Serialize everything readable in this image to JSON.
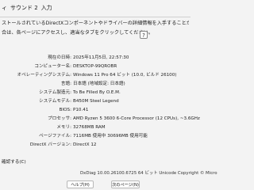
{
  "tabs": {
    "items": [
      "ィ",
      "サウンド 2",
      "入力"
    ]
  },
  "intro": {
    "line1": "ストールされているDirectXコンポーネントやドライバーの詳細情報を入手することができます。",
    "line2": "合は、各ページにアクセスし、適当なタブをクリックしてください。",
    "help_icon": "?"
  },
  "system_info": [
    {
      "label": "現在の日時:",
      "value": "2025年11月5日, 22:57:30"
    },
    {
      "label": "コンピューター名:",
      "value": "DESKTOP-99QROBR"
    },
    {
      "label": "オペレーティングシステム:",
      "value": "Windows 11 Pro 64 ビット (10.0, ビルド 26100)"
    },
    {
      "label": "言語:",
      "value": "日本語 (地域設定: 日本語)"
    },
    {
      "label": "システム製造元:",
      "value": "To Be Filled By O.E.M."
    },
    {
      "label": "システムモデル:",
      "value": "B450M Steel Legend"
    },
    {
      "label": "BIOS:",
      "value": "P10.41"
    },
    {
      "label": "プロセッサ:",
      "value": "AMD Ryzen 5 3600 6-Core Processor            (12 CPUs), ~3.6GHz"
    },
    {
      "label": "メモリ:",
      "value": "32768MB RAM"
    },
    {
      "label": "ページファイル:",
      "value": "7116MB 使用中 30696MB 使用可能"
    },
    {
      "label": "DirectX バージョン:",
      "value": "DirectX 12"
    }
  ],
  "left_note": "確認する(C)",
  "footer": {
    "version_text": "DxDiag 10.00.26100.6725 64 ビット Unicode  Copyright © Micro",
    "help_button": "ヘルプ(H)",
    "next_button": "次のページ(N)"
  }
}
